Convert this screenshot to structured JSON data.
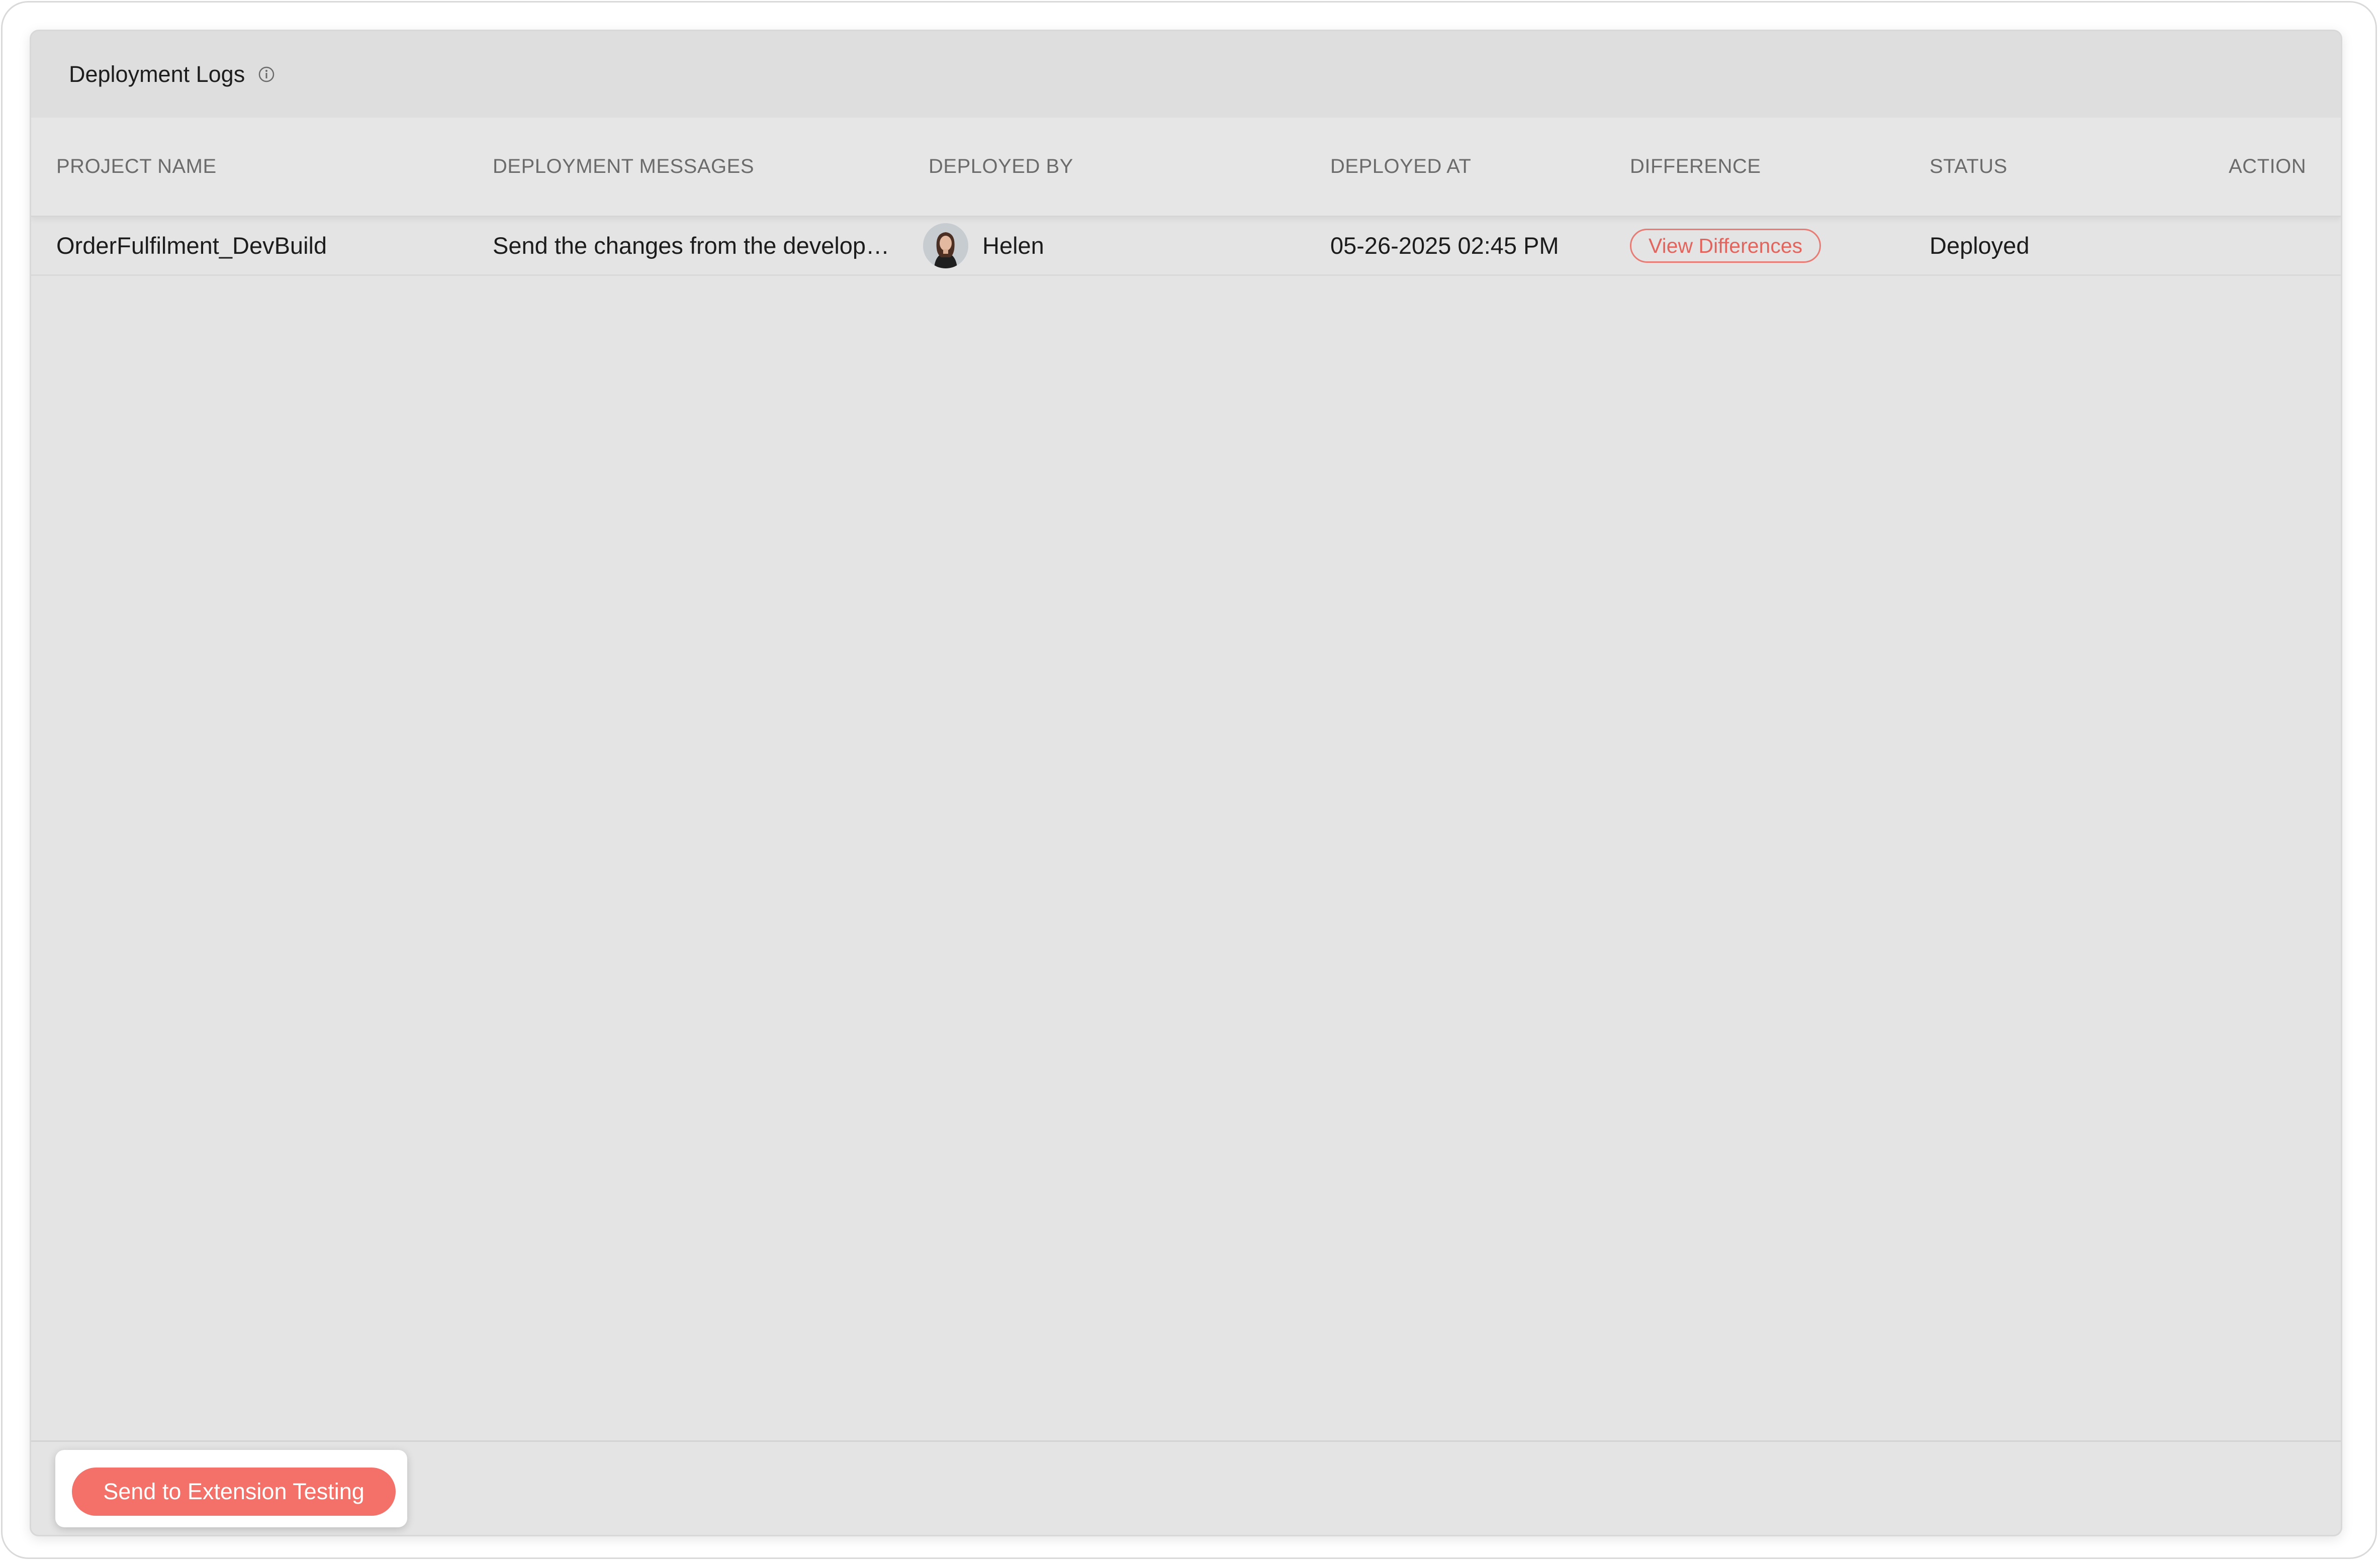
{
  "panel": {
    "title": "Deployment Logs",
    "info_icon": "info-circle-icon"
  },
  "table": {
    "columns": [
      "PROJECT NAME",
      "DEPLOYMENT MESSAGES",
      "DEPLOYED BY",
      "DEPLOYED AT",
      "DIFFERENCE",
      "STATUS",
      "ACTION"
    ],
    "rows": [
      {
        "project_name": "OrderFulfilment_DevBuild",
        "message": "Send the changes from the develop…",
        "deployed_by": "Helen",
        "avatar_icon": "user-avatar",
        "deployed_at": "05-26-2025 02:45 PM",
        "difference_label": "View Differences",
        "status": "Deployed"
      }
    ]
  },
  "footer": {
    "send_button_label": "Send to Extension Testing"
  },
  "colors": {
    "accent": "#f4716a",
    "accent_text": "#e3645c",
    "panel_bg": "#e4e4e4",
    "header_bg": "#dedede"
  }
}
